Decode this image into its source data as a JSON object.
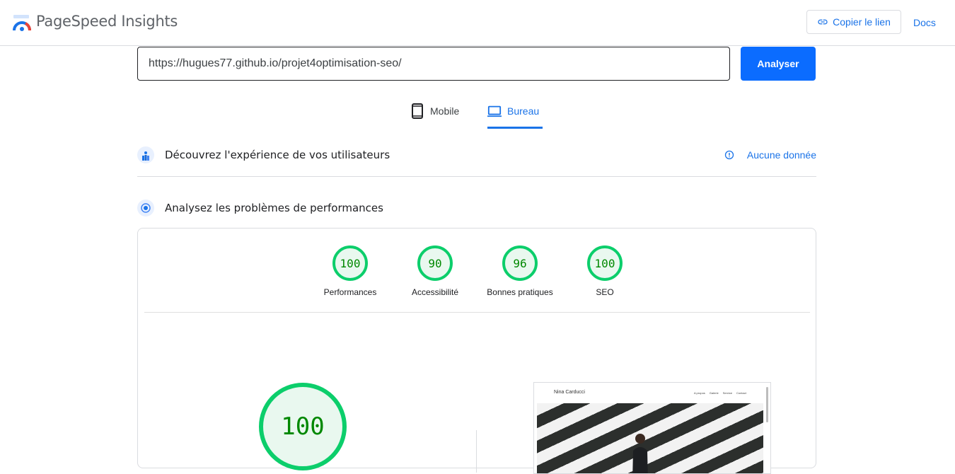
{
  "header": {
    "app_title": "PageSpeed Insights",
    "copy_link_label": "Copier le lien",
    "docs_label": "Docs"
  },
  "search": {
    "url_value": "https://hugues77.github.io/projet4optimisation-seo/",
    "analyze_label": "Analyser"
  },
  "device_tabs": [
    {
      "label": "Mobile",
      "selected": false
    },
    {
      "label": "Bureau",
      "selected": true
    }
  ],
  "field_data": {
    "title": "Découvrez l'expérience de vos utilisateurs",
    "status_label": "Aucune donnée"
  },
  "lab_data": {
    "title": "Analysez les problèmes de performances"
  },
  "scores": [
    {
      "label": "Performances",
      "value": "100"
    },
    {
      "label": "Accessibilité",
      "value": "90"
    },
    {
      "label": "Bonnes pratiques",
      "value": "96"
    },
    {
      "label": "SEO",
      "value": "100"
    }
  ],
  "main_score": "100",
  "screenshot_preview": {
    "site_name": "Nina Carducci",
    "nav_items": [
      "A propos",
      "Galerie",
      "Service",
      "Contact"
    ]
  },
  "colors": {
    "accent": "#1a73e8",
    "good_score": "#0cce6b",
    "good_score_text": "#008800",
    "good_score_fill": "#e9f8ef"
  }
}
